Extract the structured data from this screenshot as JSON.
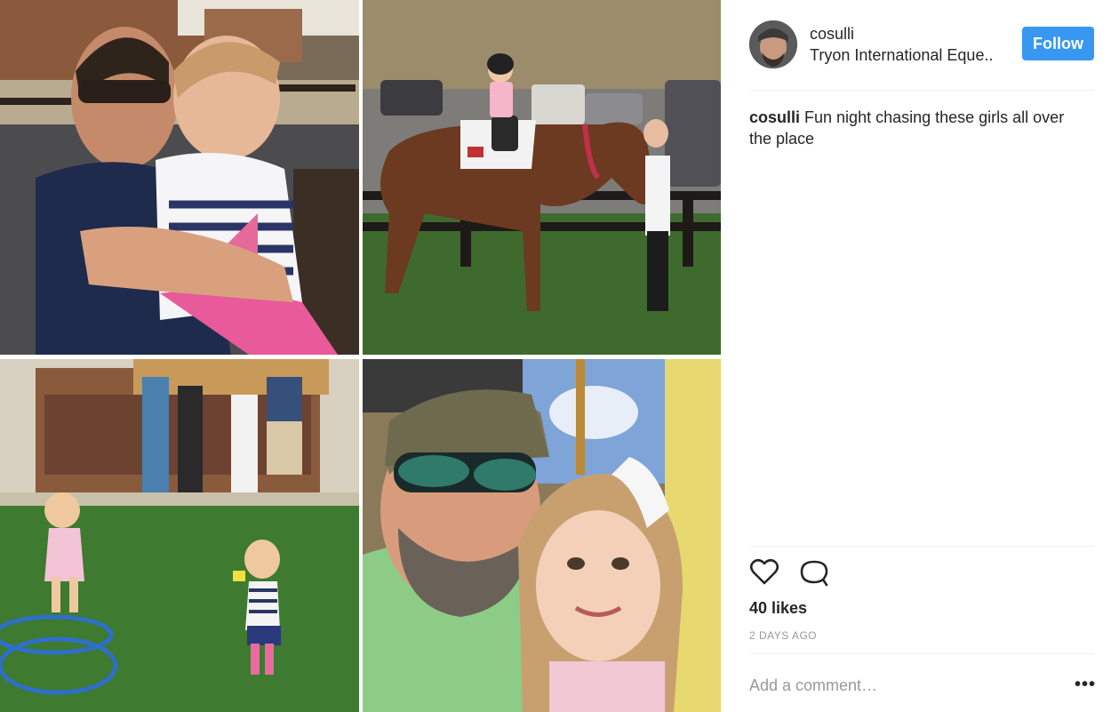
{
  "post": {
    "username": "cosulli",
    "location": "Tryon International Eque..",
    "follow_label": "Follow",
    "caption_user": "cosulli",
    "caption_text": "Fun night chasing these girls all over the place",
    "likes": "40 likes",
    "timestamp": "2 DAYS AGO",
    "comment_placeholder": "Add a comment…",
    "more_label": "•••"
  },
  "colors": {
    "follow_button": "#3897f0",
    "text": "#262626",
    "muted": "#999999"
  },
  "icons": [
    "heart-icon",
    "comment-icon",
    "more-options-icon"
  ]
}
